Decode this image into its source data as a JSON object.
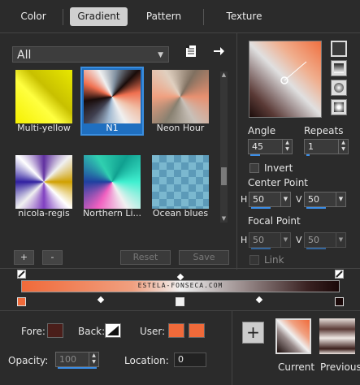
{
  "tabs": [
    {
      "label": "Color"
    },
    {
      "label": "Gradient"
    },
    {
      "label": "Pattern"
    },
    {
      "label": "Texture"
    }
  ],
  "library": {
    "category": "All",
    "items": [
      {
        "name": "Multi-yellow"
      },
      {
        "name": "N1"
      },
      {
        "name": "Neon Hour"
      },
      {
        "name": "nicola-regis"
      },
      {
        "name": "Northern Li..."
      },
      {
        "name": "Ocean blues"
      }
    ],
    "selected": "N1"
  },
  "buttons": {
    "add": "+",
    "remove": "-",
    "reset": "Reset",
    "save": "Save"
  },
  "settings": {
    "angle_label": "Angle",
    "angle_value": "45",
    "repeats_label": "Repeats",
    "repeats_value": "1",
    "invert_label": "Invert",
    "center_label": "Center Point",
    "center_h_label": "H",
    "center_h": "50",
    "center_v_label": "V",
    "center_v": "50",
    "focal_label": "Focal Point",
    "focal_h_label": "H",
    "focal_h": "50",
    "focal_v_label": "V",
    "focal_v": "50",
    "link_label": "Link"
  },
  "gradient_bar": {
    "watermark": "ESTELA-FONSECA.COM"
  },
  "stop_props": {
    "fore_label": "Fore:",
    "back_label": "Back:",
    "user_label": "User:",
    "opacity_label": "Opacity:",
    "opacity_value": "100",
    "location_label": "Location:",
    "location_value": "0"
  },
  "swatches": {
    "fore_color": "#4a1e1a",
    "user_color": "#f06a3a",
    "current_label": "Current",
    "previous_label": "Previous"
  }
}
